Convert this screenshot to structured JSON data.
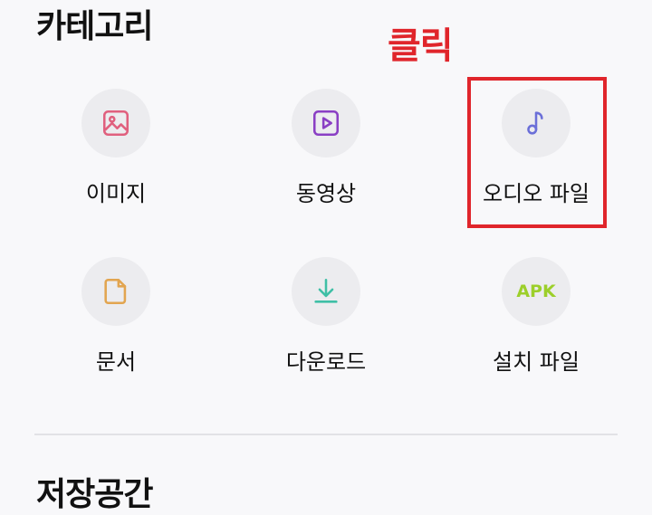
{
  "sections": {
    "category_title": "카테고리",
    "storage_title": "저장공간"
  },
  "annotation": {
    "text": "클릭",
    "color": "#e0252b"
  },
  "categories": [
    {
      "label": "이미지",
      "icon": "image-icon",
      "color": "#e0607e"
    },
    {
      "label": "동영상",
      "icon": "video-icon",
      "color": "#8a3fc4"
    },
    {
      "label": "오디오 파일",
      "icon": "music-note-icon",
      "color": "#6b6fd8",
      "highlighted": true
    },
    {
      "label": "문서",
      "icon": "document-icon",
      "color": "#e2a550"
    },
    {
      "label": "다운로드",
      "icon": "download-icon",
      "color": "#3fbfa6"
    },
    {
      "label": "설치 파일",
      "icon": "apk-icon",
      "icon_text": "APK",
      "color": "#9ccf2a"
    }
  ]
}
